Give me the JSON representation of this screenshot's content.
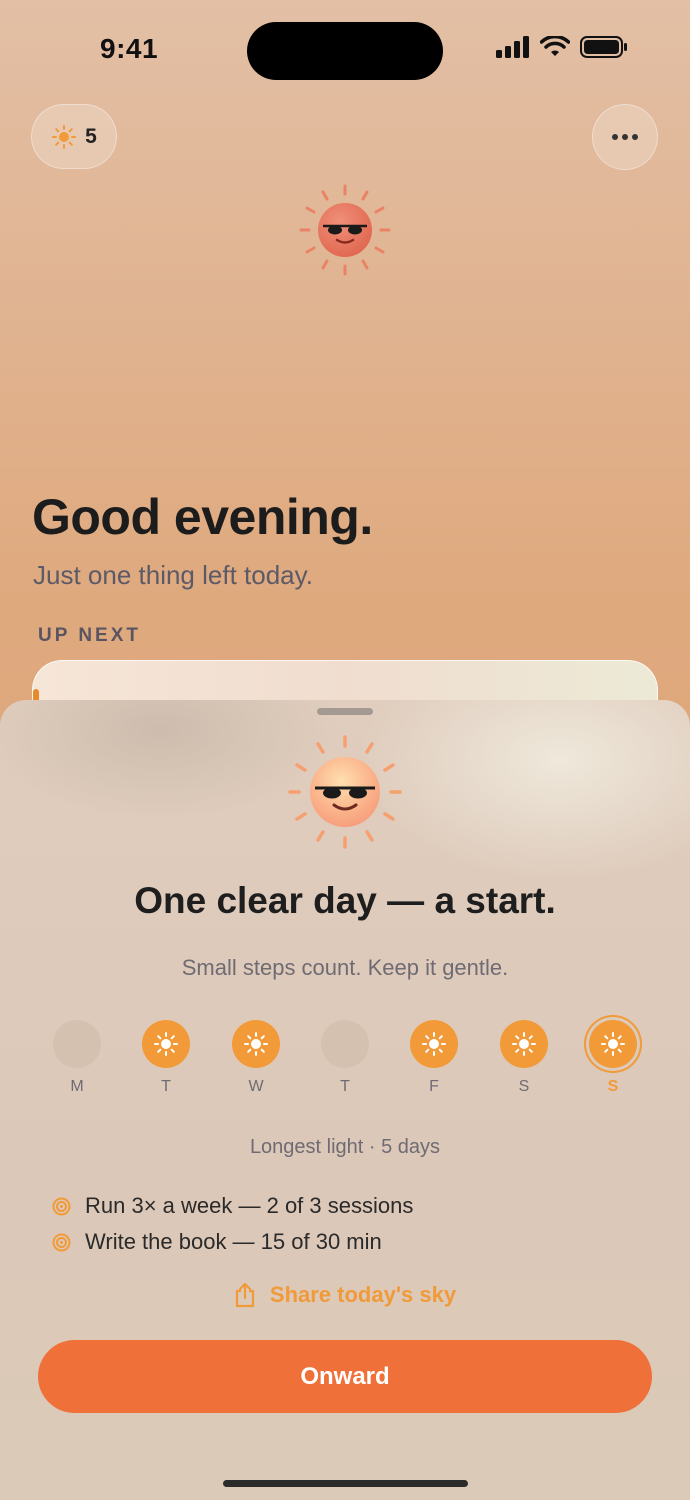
{
  "status": {
    "time": "9:41"
  },
  "header": {
    "streak_count": "5"
  },
  "greeting": {
    "title": "Good evening.",
    "subtitle": "Just one thing left today.",
    "section_label": "UP NEXT"
  },
  "sheet": {
    "title": "One clear day — a start.",
    "subtitle": "Small steps count. Keep it gentle.",
    "week": [
      {
        "label": "M",
        "state": "empty"
      },
      {
        "label": "T",
        "state": "lit"
      },
      {
        "label": "W",
        "state": "lit"
      },
      {
        "label": "T",
        "state": "empty"
      },
      {
        "label": "F",
        "state": "lit"
      },
      {
        "label": "S",
        "state": "lit"
      },
      {
        "label": "S",
        "state": "today"
      }
    ],
    "longest": "Longest light · 5 days",
    "goals": [
      {
        "text": "Run 3× a week — 2 of 3 sessions"
      },
      {
        "text": "Write the book — 15 of 30 min"
      }
    ],
    "share_label": "Share today's sky",
    "cta_label": "Onward"
  },
  "colors": {
    "accent": "#f19a37",
    "cta": "#ef7039",
    "text": "#1e1e1e",
    "muted": "#6f6b73"
  },
  "icons": {
    "streak": "sun-icon",
    "more": "ellipsis-icon",
    "goal": "target-icon",
    "share": "share-icon"
  }
}
